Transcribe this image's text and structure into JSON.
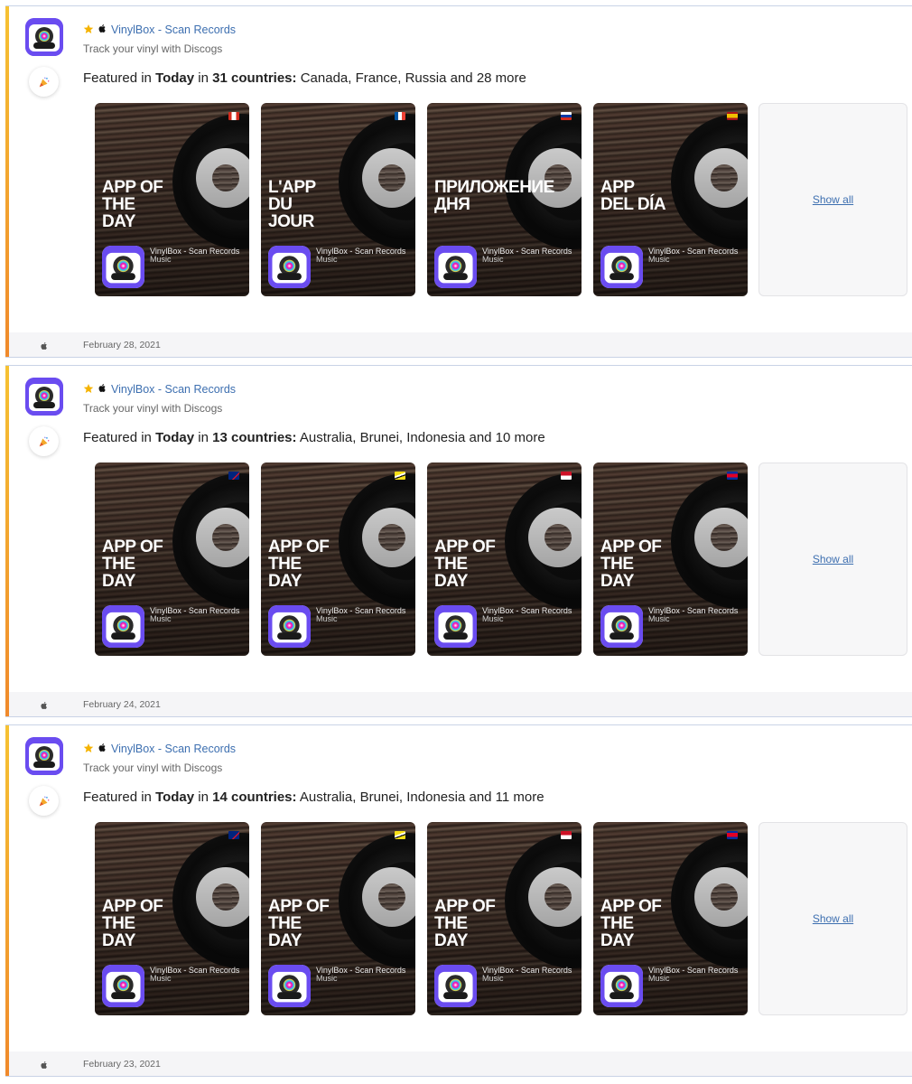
{
  "colors": {
    "link": "#3d6fb0",
    "accent_top": "#f6c233",
    "accent_bottom": "#f08a2c",
    "icon_purple": "#6a4cf0"
  },
  "cards": [
    {
      "app_name": "VinylBox - Scan Records",
      "subtitle": "Track your vinyl with Discogs",
      "featured_prefix": "Featured in",
      "featured_story": "Today",
      "featured_in": "in",
      "featured_count": "31 countries:",
      "featured_list": "Canada, France, Russia and 28 more",
      "show_all": "Show all",
      "date": "February 28, 2021",
      "tiles": [
        {
          "title": "APP OF\nTHE\nDAY",
          "flag": "canada-flag",
          "app": "VinylBox - Scan Records",
          "category": "Music"
        },
        {
          "title": "L'APP\nDU\nJOUR",
          "flag": "france-flag",
          "app": "VinylBox - Scan Records",
          "category": "Music"
        },
        {
          "title": "ПРИЛОЖЕНИЕ\nДНЯ",
          "flag": "russia-flag",
          "app": "VinylBox - Scan Records",
          "category": "Music"
        },
        {
          "title": "APP\nDEL DÍA",
          "flag": "spain-flag",
          "app": "VinylBox - Scan Records",
          "category": "Music"
        }
      ]
    },
    {
      "app_name": "VinylBox - Scan Records",
      "subtitle": "Track your vinyl with Discogs",
      "featured_prefix": "Featured in",
      "featured_story": "Today",
      "featured_in": "in",
      "featured_count": "13 countries:",
      "featured_list": "Australia, Brunei, Indonesia and 10 more",
      "show_all": "Show all",
      "date": "February 24, 2021",
      "tiles": [
        {
          "title": "APP OF\nTHE\nDAY",
          "flag": "australia-flag",
          "app": "VinylBox - Scan Records",
          "category": "Music"
        },
        {
          "title": "APP OF\nTHE\nDAY",
          "flag": "brunei-flag",
          "app": "VinylBox - Scan Records",
          "category": "Music"
        },
        {
          "title": "APP OF\nTHE\nDAY",
          "flag": "indonesia-flag",
          "app": "VinylBox - Scan Records",
          "category": "Music"
        },
        {
          "title": "APP OF\nTHE\nDAY",
          "flag": "cambodia-flag",
          "app": "VinylBox - Scan Records",
          "category": "Music"
        }
      ]
    },
    {
      "app_name": "VinylBox - Scan Records",
      "subtitle": "Track your vinyl with Discogs",
      "featured_prefix": "Featured in",
      "featured_story": "Today",
      "featured_in": "in",
      "featured_count": "14 countries:",
      "featured_list": "Australia, Brunei, Indonesia and 11 more",
      "show_all": "Show all",
      "date": "February 23, 2021",
      "tiles": [
        {
          "title": "APP OF\nTHE\nDAY",
          "flag": "australia-flag",
          "app": "VinylBox - Scan Records",
          "category": "Music"
        },
        {
          "title": "APP OF\nTHE\nDAY",
          "flag": "brunei-flag",
          "app": "VinylBox - Scan Records",
          "category": "Music"
        },
        {
          "title": "APP OF\nTHE\nDAY",
          "flag": "indonesia-flag",
          "app": "VinylBox - Scan Records",
          "category": "Music"
        },
        {
          "title": "APP OF\nTHE\nDAY",
          "flag": "cambodia-flag",
          "app": "VinylBox - Scan Records",
          "category": "Music"
        }
      ]
    }
  ]
}
